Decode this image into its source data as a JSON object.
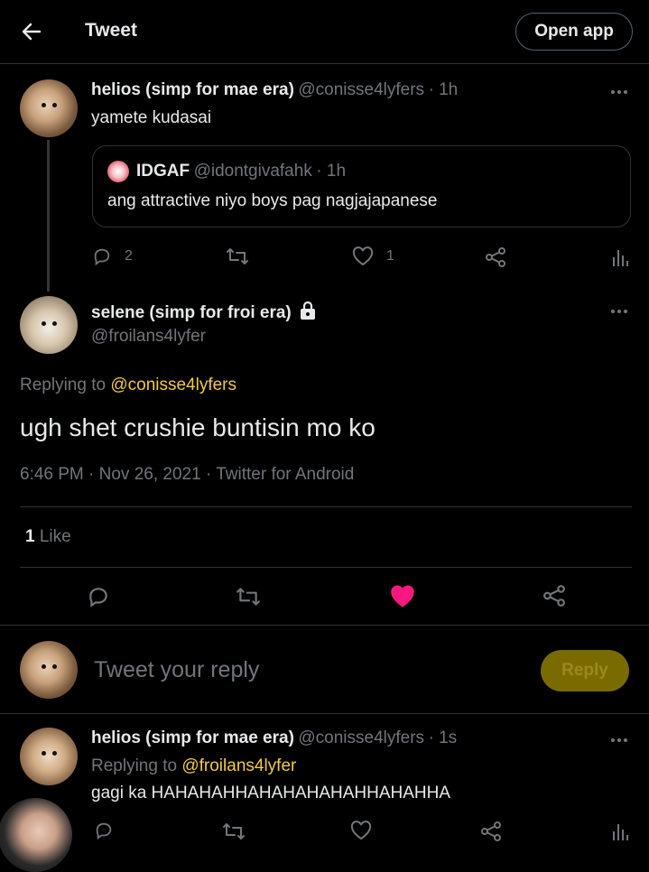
{
  "header": {
    "title": "Tweet",
    "open_app_label": "Open app"
  },
  "parent_tweet": {
    "display_name": "helios (simp for mae era)",
    "handle": "@conisse4lyfers",
    "time": "· 1h",
    "text": "yamete kudasai",
    "quote": {
      "display_name": "IDGAF",
      "handle": "@idontgivafahk",
      "time": "· 1h",
      "text": "ang attractive niyo boys pag nagjajapanese"
    },
    "reply_count": "2",
    "like_count": "1"
  },
  "main_tweet": {
    "display_name": "selene (simp for froi era)",
    "handle": "@froilans4lyfer",
    "replying_prefix": "Replying to",
    "replying_handle": "@conisse4lyfers",
    "text": "ugh shet crushie buntisin mo ko",
    "meta": "6:46 PM · Nov 26, 2021 · Twitter for Android",
    "like_count": "1",
    "like_label": "Like"
  },
  "composer": {
    "placeholder": "Tweet your reply",
    "reply_button": "Reply"
  },
  "reply_tweet": {
    "display_name": "helios (simp for mae era)",
    "handle": "@conisse4lyfers",
    "time": "· 1s",
    "replying_prefix": "Replying to",
    "replying_handle": "@froilans4lyfer",
    "text": "gagi ka HAHAHAHHAHAHAHAHAHHAHAHHA"
  },
  "colors": {
    "accent_link": "#f2c84b",
    "like_pink": "#f91880",
    "reply_button_bg": "#7a6b00"
  },
  "icons": [
    "back-arrow-icon",
    "reply-icon",
    "retweet-icon",
    "heart-icon",
    "share-icon",
    "analytics-icon",
    "more-icon",
    "lock-icon"
  ]
}
